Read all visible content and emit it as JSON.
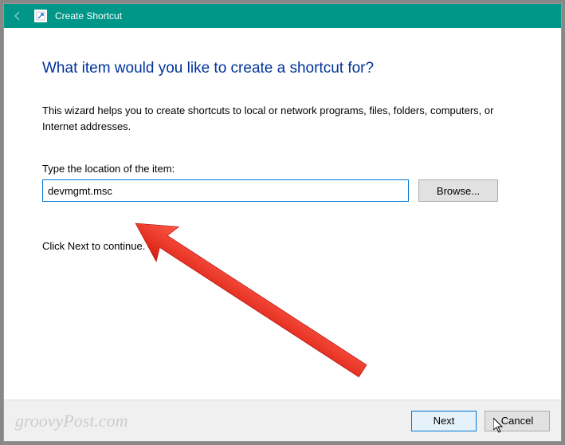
{
  "window": {
    "title": "Create Shortcut"
  },
  "wizard": {
    "heading": "What item would you like to create a shortcut for?",
    "description": "This wizard helps you to create shortcuts to local or network programs, files, folders, computers, or Internet addresses.",
    "field_label": "Type the location of the item:",
    "location_value": "devmgmt.msc",
    "browse_label": "Browse...",
    "continue_hint": "Click Next to continue."
  },
  "footer": {
    "watermark": "groovyPost.com",
    "next_label": "Next",
    "cancel_label": "Cancel"
  }
}
